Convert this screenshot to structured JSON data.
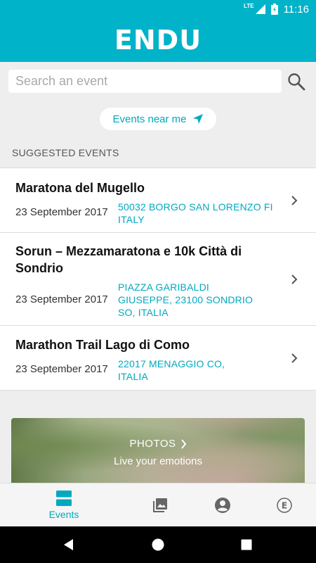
{
  "status_bar": {
    "network": "LTE",
    "time": "11:16"
  },
  "app": {
    "logo": "ENDU"
  },
  "search": {
    "placeholder": "Search an event"
  },
  "near_me": {
    "label": "Events near me"
  },
  "suggested": {
    "title": "SUGGESTED EVENTS",
    "events": [
      {
        "title": "Maratona del Mugello",
        "date": "23 September 2017",
        "location": "50032 BORGO SAN LORENZO FI ITALY"
      },
      {
        "title": "Sorun – Mezzamaratona e 10k Città di Sondrio",
        "date": "23 September 2017",
        "location": "PIAZZA GARIBALDI GIUSEPPE, 23100 SONDRIO SO, ITALIA"
      },
      {
        "title": "Marathon Trail Lago di Como",
        "date": "23 September 2017",
        "location": "22017 MENAGGIO CO, ITALIA"
      }
    ]
  },
  "photos": {
    "title": "PHOTOS",
    "subtitle": "Live your emotions"
  },
  "bottom_nav": {
    "events_label": "Events",
    "active_color": "#00a9bf",
    "icons": [
      "events-icon",
      "photos-icon",
      "profile-icon",
      "endu-e-icon"
    ]
  },
  "colors": {
    "brand": "#00b3c8",
    "accent": "#00a9bf"
  }
}
